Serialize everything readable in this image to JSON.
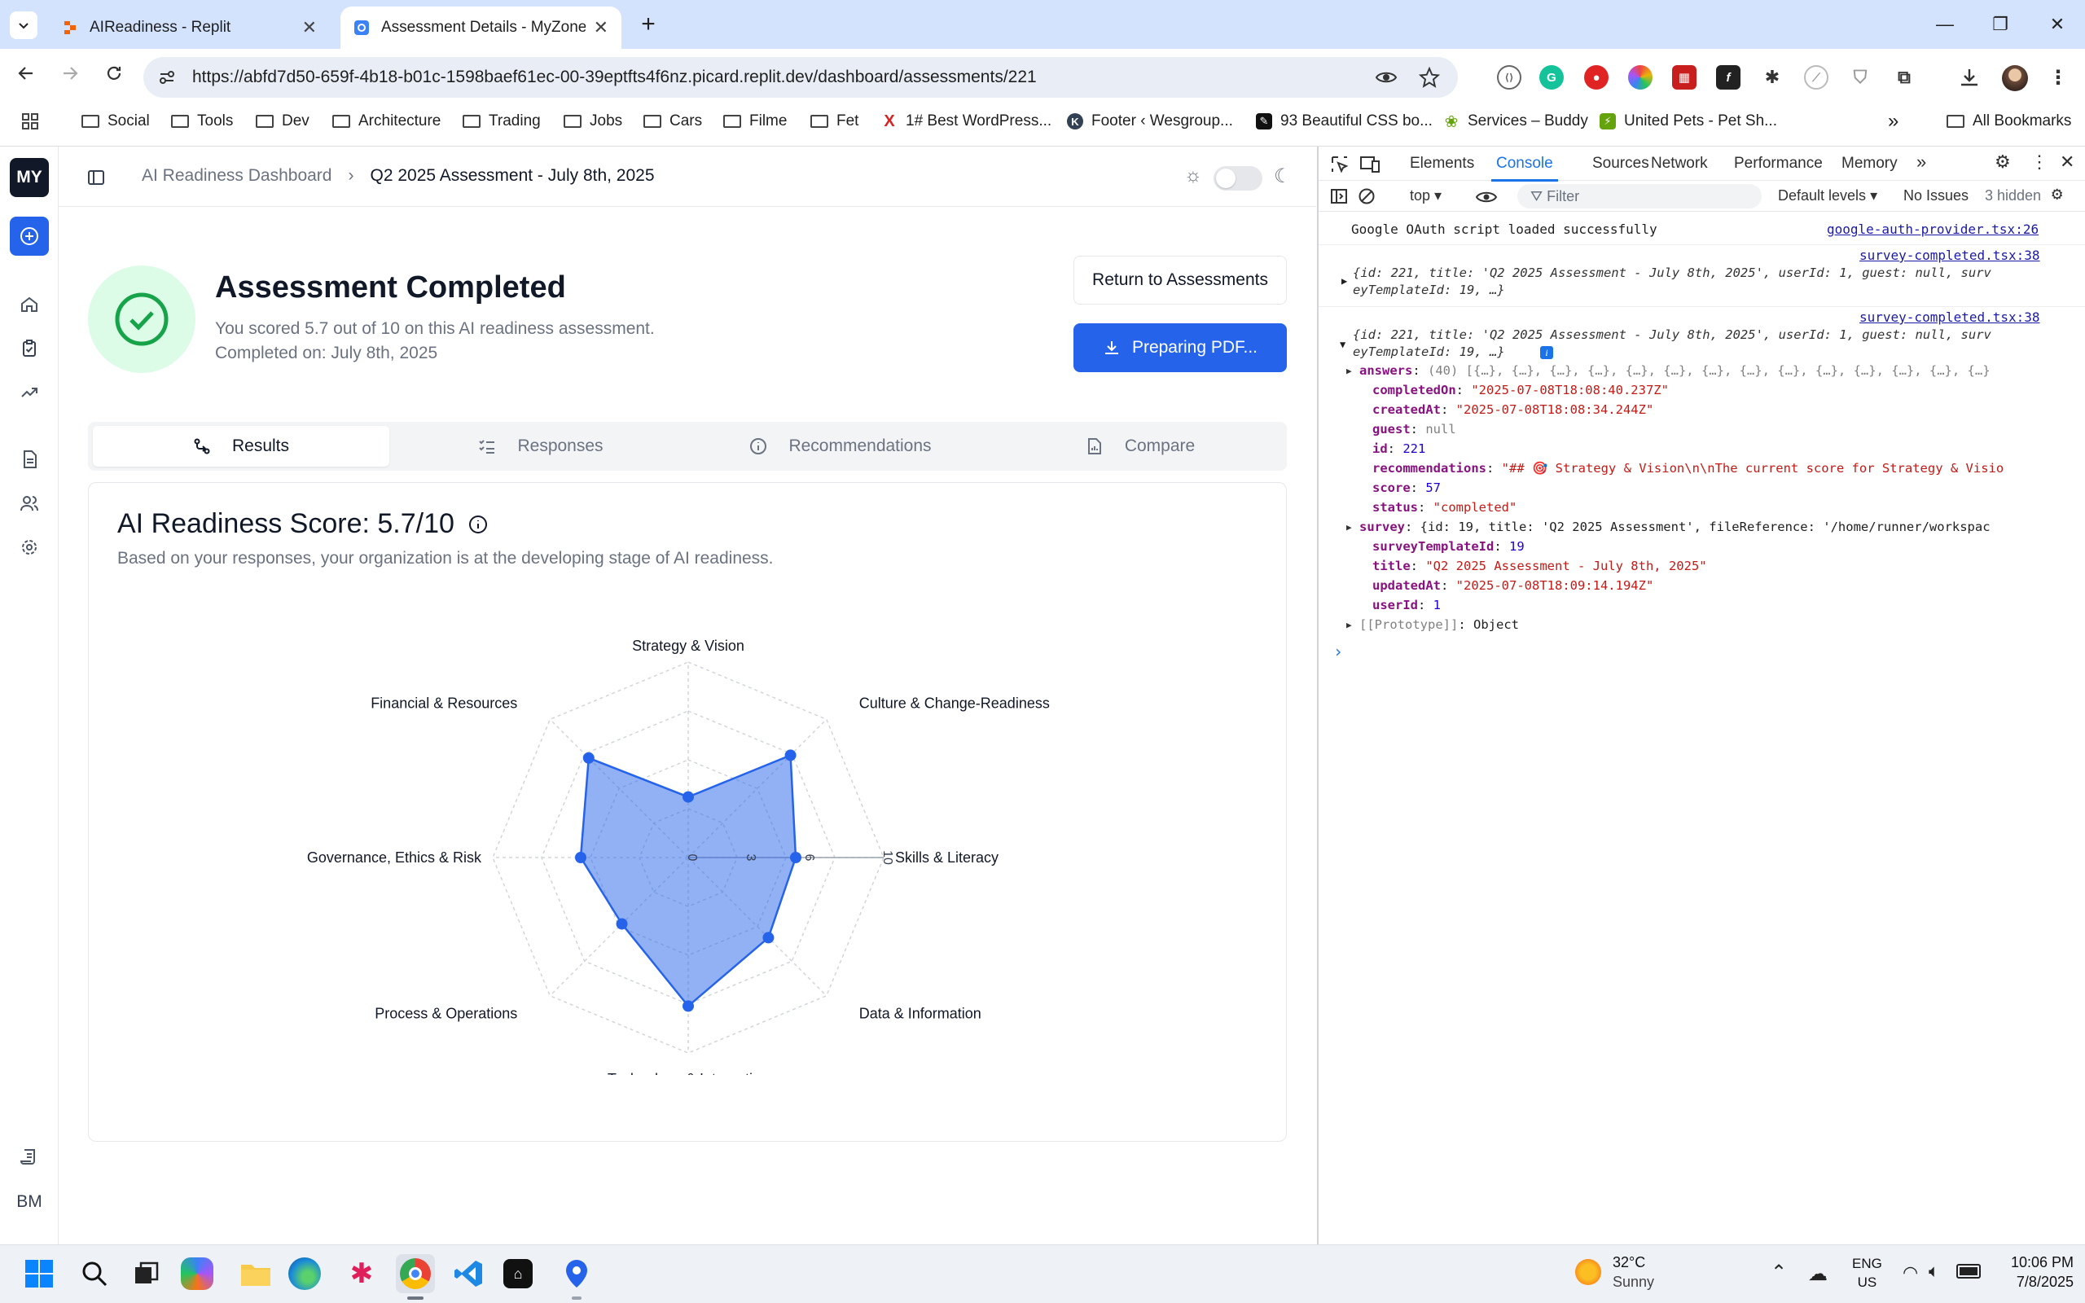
{
  "browser": {
    "tabs": [
      {
        "title": "AIReadiness - Replit",
        "active": false
      },
      {
        "title": "Assessment Details - MyZone A",
        "active": true
      }
    ],
    "url": "https://abfd7d50-659f-4b18-b01c-1598baef61ec-00-39eptfts4f6nz.picard.replit.dev/dashboard/assessments/221",
    "bookmarks": [
      "Social",
      "Tools",
      "Dev",
      "Architecture",
      "Trading",
      "Jobs",
      "Cars",
      "Filme",
      "Fet",
      "1# Best WordPress...",
      "Footer ‹ Wesgroup...",
      "93 Beautiful CSS bo...",
      "Services – Buddy",
      "United Pets - Pet Sh..."
    ],
    "all_bookmarks": "All Bookmarks",
    "colors": {
      "tabstrip": "#d3e3fd",
      "accent": "#2563eb",
      "success": "#16a34a"
    }
  },
  "app": {
    "logo": "MY",
    "user_initials": "BM",
    "breadcrumb": {
      "root": "AI Readiness Dashboard",
      "current": "Q2 2025 Assessment - July 8th, 2025"
    },
    "header": {
      "title": "Assessment Completed",
      "score_text": "You scored 5.7 out of 10 on this AI readiness assessment.",
      "completed_text": "Completed on: July 8th, 2025",
      "return_button": "Return to Assessments",
      "pdf_button": "Preparing PDF..."
    },
    "tabs": [
      "Results",
      "Responses",
      "Recommendations",
      "Compare"
    ],
    "active_tab": "Results",
    "score_card": {
      "title": "AI Readiness Score: 5.7/10",
      "subtitle": "Based on your responses, your organization is at the developing stage of AI readiness."
    }
  },
  "chart_data": {
    "type": "radar",
    "categories": [
      "Strategy & Vision",
      "Culture & Change-Readiness",
      "Skills & Literacy",
      "Data & Information",
      "Technology & Integration",
      "Process & Operations",
      "Governance, Ethics & Risk",
      "Financial & Resources"
    ],
    "values": [
      3.1,
      7.4,
      5.5,
      5.8,
      7.6,
      4.8,
      5.5,
      7.2
    ],
    "radial_ticks": [
      "0",
      "3",
      "6",
      "10"
    ],
    "range": [
      0,
      10
    ],
    "grid": true,
    "color": "#2563eb"
  },
  "devtools": {
    "tabs": [
      "Elements",
      "Console",
      "Sources",
      "Network",
      "Performance",
      "Memory"
    ],
    "active_tab": "Console",
    "context": "top",
    "filter_placeholder": "Filter",
    "levels": "Default levels",
    "issues": "No Issues",
    "hidden": "3 hidden",
    "log1": {
      "text": "Google OAuth script loaded successfully",
      "source": "google-auth-provider.tsx:26"
    },
    "log2_source": "survey-completed.tsx:38",
    "log2_line1": "{id: 221, title: 'Q2 2025 Assessment - July 8th, 2025', userId: 1, guest: null, surv",
    "log2_line2": "eyTemplateId: 19, …}",
    "log3_source": "survey-completed.tsx:38",
    "log3_line1": "{id: 221, title: 'Q2 2025 Assessment - July 8th, 2025', userId: 1, guest: null, surv",
    "log3_line2": "eyTemplateId: 19, …}",
    "props": [
      {
        "key": "answers",
        "value": "(40) [{…}, {…}, {…}, {…}, {…}, {…}, {…}, {…}, {…}, {…}, {…}, {…}, {…}, {…}"
      },
      {
        "key": "completedOn",
        "value": "\"2025-07-08T18:08:40.237Z\""
      },
      {
        "key": "createdAt",
        "value": "\"2025-07-08T18:08:34.244Z\""
      },
      {
        "key": "guest",
        "value": "null"
      },
      {
        "key": "id",
        "value": "221"
      },
      {
        "key": "recommendations",
        "value": "\"## 🎯 Strategy & Vision\\n\\nThe current score for Strategy & Visio"
      },
      {
        "key": "score",
        "value": "57"
      },
      {
        "key": "status",
        "value": "\"completed\""
      },
      {
        "key": "survey",
        "value": "{id: 19, title: 'Q2 2025 Assessment', fileReference: '/home/runner/workspac"
      },
      {
        "key": "surveyTemplateId",
        "value": "19"
      },
      {
        "key": "title",
        "value": "\"Q2 2025 Assessment - July 8th, 2025\""
      },
      {
        "key": "updatedAt",
        "value": "\"2025-07-08T18:09:14.194Z\""
      },
      {
        "key": "userId",
        "value": "1"
      },
      {
        "key": "[[Prototype]]",
        "value": "Object"
      }
    ],
    "prompt": "›"
  },
  "taskbar": {
    "weather_temp": "32°C",
    "weather_desc": "Sunny",
    "lang1": "ENG",
    "lang2": "US",
    "time": "10:06 PM",
    "date": "7/8/2025"
  }
}
